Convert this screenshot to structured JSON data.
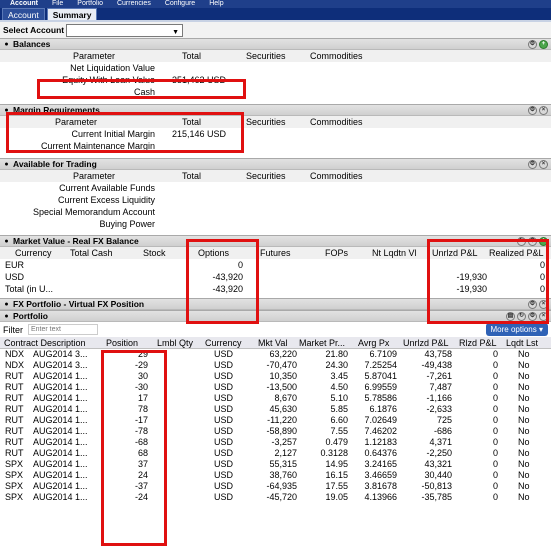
{
  "title_bar": {
    "title": "Account",
    "menu": [
      "File",
      "Portfolio",
      "Currencies",
      "Configure",
      "Help"
    ]
  },
  "tabs": [
    {
      "label": "Account"
    },
    {
      "label": "Summary"
    }
  ],
  "select_account": {
    "label": "Select Account",
    "value": ""
  },
  "balances": {
    "title": "Balances",
    "columns": [
      "Parameter",
      "Total",
      "Securities",
      "Commodities"
    ],
    "rows": [
      {
        "param": "Net Liquidation Value",
        "total": ""
      },
      {
        "param": "Equity With Loan Value",
        "total": "351,462 USD"
      },
      {
        "param": "Cash",
        "total": ""
      }
    ]
  },
  "margin": {
    "title": "Margin Requirements",
    "columns": [
      "Parameter",
      "Total",
      "Securities",
      "Commodities"
    ],
    "rows": [
      {
        "param": "Current Initial Margin",
        "total": "215,146 USD"
      },
      {
        "param": "Current Maintenance Margin",
        "total": ""
      }
    ]
  },
  "trading": {
    "title": "Available for Trading",
    "columns": [
      "Parameter",
      "Total",
      "Securities",
      "Commodities"
    ],
    "rows": [
      {
        "param": "Current Available Funds"
      },
      {
        "param": "Current Excess Liquidity"
      },
      {
        "param": "Special Memorandum Account"
      },
      {
        "param": "Buying Power"
      }
    ]
  },
  "market": {
    "title": "Market Value - Real FX Balance",
    "columns": [
      "Currency",
      "Total Cash",
      "Stock",
      "Options",
      "Futures",
      "FOPs",
      "Nt Lqdtn Vl",
      "Unrlzd P&L",
      "Realized P&L"
    ],
    "rows": [
      {
        "currency": "EUR",
        "options": "0",
        "unrlzd": "",
        "realized": "0"
      },
      {
        "currency": "USD",
        "options": "-43,920",
        "unrlzd": "-19,930",
        "realized": "0"
      },
      {
        "currency": "Total (in U...",
        "options": "-43,920",
        "unrlzd": "-19,930",
        "realized": "0"
      }
    ]
  },
  "fx": {
    "title": "FX Portfolio - Virtual FX Position"
  },
  "portfolio": {
    "title": "Portfolio",
    "filter_label": "Filter",
    "filter_placeholder": "Enter text",
    "more_options": "More options",
    "columns": [
      "Contract Description",
      "Position",
      "Lmbl Qty",
      "Currency",
      "Mkt Val",
      "Market Pr...",
      "Avrg Px",
      "Unrlzd P&L",
      "Rlzd P&L",
      "Lqdt Lst"
    ],
    "rows": [
      {
        "sym": "NDX",
        "exp": "AUG2014 3...",
        "pos": "29",
        "cur": "USD",
        "mkt": "63,220",
        "mp": "21.80",
        "avg": "6.7109",
        "unr": "43,758",
        "rlz": "0",
        "lq": "No"
      },
      {
        "sym": "NDX",
        "exp": "AUG2014 3...",
        "pos": "-29",
        "cur": "USD",
        "mkt": "-70,470",
        "mp": "24.30",
        "avg": "7.25254",
        "unr": "-49,438",
        "rlz": "0",
        "lq": "No"
      },
      {
        "sym": "RUT",
        "exp": "AUG2014 1...",
        "pos": "30",
        "cur": "USD",
        "mkt": "10,350",
        "mp": "3.45",
        "avg": "5.87041",
        "unr": "-7,261",
        "rlz": "0",
        "lq": "No"
      },
      {
        "sym": "RUT",
        "exp": "AUG2014 1...",
        "pos": "-30",
        "cur": "USD",
        "mkt": "-13,500",
        "mp": "4.50",
        "avg": "6.99559",
        "unr": "7,487",
        "rlz": "0",
        "lq": "No"
      },
      {
        "sym": "RUT",
        "exp": "AUG2014 1...",
        "pos": "17",
        "cur": "USD",
        "mkt": "8,670",
        "mp": "5.10",
        "avg": "5.78586",
        "unr": "-1,166",
        "rlz": "0",
        "lq": "No"
      },
      {
        "sym": "RUT",
        "exp": "AUG2014 1...",
        "pos": "78",
        "cur": "USD",
        "mkt": "45,630",
        "mp": "5.85",
        "avg": "6.1876",
        "unr": "-2,633",
        "rlz": "0",
        "lq": "No"
      },
      {
        "sym": "RUT",
        "exp": "AUG2014 1...",
        "pos": "-17",
        "cur": "USD",
        "mkt": "-11,220",
        "mp": "6.60",
        "avg": "7.02649",
        "unr": "725",
        "rlz": "0",
        "lq": "No"
      },
      {
        "sym": "RUT",
        "exp": "AUG2014 1...",
        "pos": "-78",
        "cur": "USD",
        "mkt": "-58,890",
        "mp": "7.55",
        "avg": "7.46202",
        "unr": "-686",
        "rlz": "0",
        "lq": "No"
      },
      {
        "sym": "RUT",
        "exp": "AUG2014 1...",
        "pos": "-68",
        "cur": "USD",
        "mkt": "-3,257",
        "mp": "0.479",
        "avg": "1.12183",
        "unr": "4,371",
        "rlz": "0",
        "lq": "No"
      },
      {
        "sym": "RUT",
        "exp": "AUG2014 1...",
        "pos": "68",
        "cur": "USD",
        "mkt": "2,127",
        "mp": "0.3128",
        "avg": "0.64376",
        "unr": "-2,250",
        "rlz": "0",
        "lq": "No"
      },
      {
        "sym": "SPX",
        "exp": "AUG2014 1...",
        "pos": "37",
        "cur": "USD",
        "mkt": "55,315",
        "mp": "14.95",
        "avg": "3.24165",
        "unr": "43,321",
        "rlz": "0",
        "lq": "No"
      },
      {
        "sym": "SPX",
        "exp": "AUG2014 1...",
        "pos": "24",
        "cur": "USD",
        "mkt": "38,760",
        "mp": "16.15",
        "avg": "3.46659",
        "unr": "30,440",
        "rlz": "0",
        "lq": "No"
      },
      {
        "sym": "SPX",
        "exp": "AUG2014 1...",
        "pos": "-37",
        "cur": "USD",
        "mkt": "-64,935",
        "mp": "17.55",
        "avg": "3.81678",
        "unr": "-50,813",
        "rlz": "0",
        "lq": "No"
      },
      {
        "sym": "SPX",
        "exp": "AUG2014 1...",
        "pos": "-24",
        "cur": "USD",
        "mkt": "-45,720",
        "mp": "19.05",
        "avg": "4.13966",
        "unr": "-35,785",
        "rlz": "0",
        "lq": "No"
      }
    ]
  },
  "colors": {
    "title_bar": "#1f3f8a",
    "highlight_box": "#e01010",
    "more_options": "#2f62b6"
  }
}
